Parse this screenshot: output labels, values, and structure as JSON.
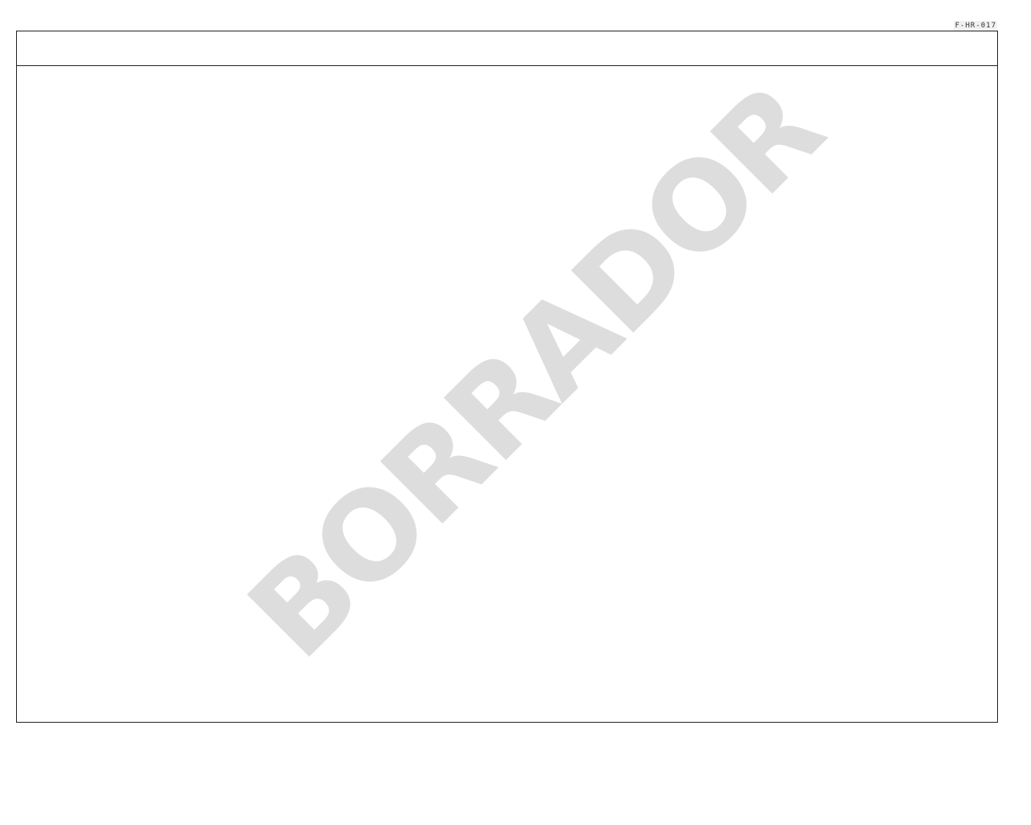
{
  "document": {
    "form_code": "F-HR-017",
    "watermark": "BORRADOR"
  },
  "colors": {
    "border": "#222222",
    "watermark": "#dddddd",
    "background": "#ffffff"
  }
}
